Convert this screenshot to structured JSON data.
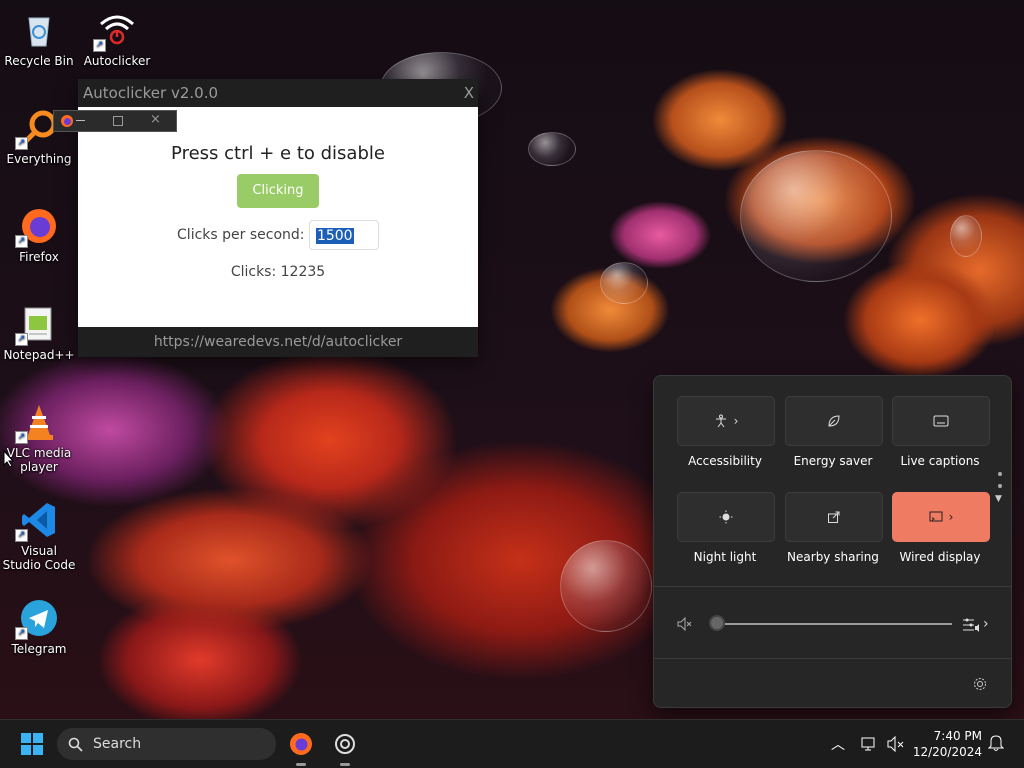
{
  "desktop_icons": [
    {
      "label": "Recycle Bin"
    },
    {
      "label": "Autoclicker"
    },
    {
      "label": "Everything"
    },
    {
      "label": "Firefox"
    },
    {
      "label": "Notepad++"
    },
    {
      "label": "VLC media player"
    },
    {
      "label": "Visual Studio Code"
    },
    {
      "label": "Telegram"
    }
  ],
  "autoclicker": {
    "title": "Autoclicker v2.0.0",
    "close_label": "X",
    "heading": "Press ctrl + e to disable",
    "button_label": "Clicking",
    "cps_label": "Clicks per second:",
    "cps_value": "1500",
    "clicks_text": "Clicks: 12235",
    "footer_url": "https://wearedevs.net/d/autoclicker"
  },
  "quick_settings": {
    "tiles": [
      {
        "label": "Accessibility",
        "icon": "accessibility-icon",
        "has_chevron": true,
        "active": false
      },
      {
        "label": "Energy saver",
        "icon": "leaf-icon",
        "has_chevron": false,
        "active": false
      },
      {
        "label": "Live captions",
        "icon": "captions-icon",
        "has_chevron": false,
        "active": false
      },
      {
        "label": "Night light",
        "icon": "night-light-icon",
        "has_chevron": false,
        "active": false
      },
      {
        "label": "Nearby sharing",
        "icon": "share-icon",
        "has_chevron": false,
        "active": false
      },
      {
        "label": "Wired display",
        "icon": "cast-icon",
        "has_chevron": true,
        "active": true
      }
    ],
    "volume_level": 0
  },
  "taskbar": {
    "search_placeholder": "Search",
    "time": "7:40 PM",
    "date": "12/20/2024"
  },
  "colors": {
    "accent_tile": "#ef7b63",
    "clicking_button": "#99cc66"
  }
}
